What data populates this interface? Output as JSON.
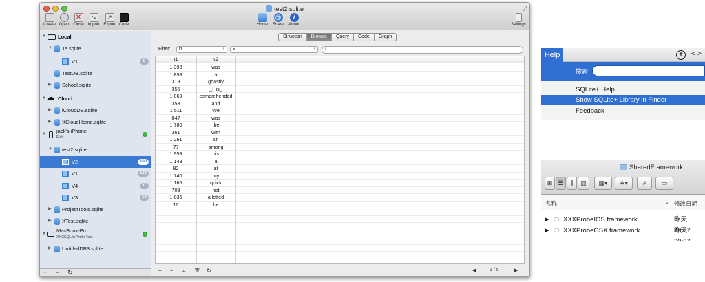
{
  "window": {
    "title": "test2.sqlite",
    "toolbar": {
      "left": [
        {
          "label": "Create",
          "icon": "create-icon"
        },
        {
          "label": "Open",
          "icon": "open-icon"
        },
        {
          "label": "Close",
          "icon": "close-icon"
        },
        {
          "label": "Import",
          "icon": "import-icon"
        },
        {
          "label": "Export",
          "icon": "export-icon"
        },
        {
          "label": "Code",
          "icon": "code-icon"
        }
      ],
      "center": [
        {
          "label": "Home",
          "icon": "home-icon"
        },
        {
          "label": "Share",
          "icon": "share-icon"
        },
        {
          "label": "About",
          "icon": "about-icon"
        }
      ],
      "right": {
        "label": "Settings",
        "icon": "settings-icon"
      }
    }
  },
  "sidebar": {
    "local": "Local",
    "cloud": "Cloud",
    "te": "Te.sqlite",
    "te_v1": "V1",
    "te_v1_badge": "0",
    "testdb": "TestDB.sqlite",
    "school": "School.sqlite",
    "icloud": "iCloudDB.sqlite",
    "xcloud": "XCloudHome.sqlite",
    "iphone": "jack's iPhone",
    "iphone_sub": "Fish",
    "test2": "test2.sqlite",
    "v2": "V2",
    "v2_badge": "100",
    "v1": "V1",
    "v1_badge": "130",
    "v4": "V4",
    "v4_badge": "0",
    "v3": "V3",
    "v3_badge": "10",
    "projecttools": "ProjectTools.sqlite",
    "xtest": "XTest.sqlite",
    "macbook": "MacBook-Pro",
    "macbook_sub": "XXXSQLiteProbeTest",
    "untitled": "UntitledDB3.sqlite",
    "footer": {
      "add": "+",
      "remove": "−",
      "refresh": "↻"
    }
  },
  "content": {
    "tabs": [
      "Struction",
      "Browse",
      "Query",
      "Code",
      "Graph"
    ],
    "active_tab": "Browse",
    "filter_label": "Filter:",
    "filter_column": "t1",
    "filter_operator": "=",
    "filter_value": "",
    "columns": [
      "t1",
      "v2"
    ],
    "rows": [
      [
        "1,398",
        "was"
      ],
      [
        "1,858",
        "a"
      ],
      [
        "313",
        "ghastly"
      ],
      [
        "355",
        "_His_"
      ],
      [
        "1,069",
        "comprehended"
      ],
      [
        "353",
        "and"
      ],
      [
        "1,511",
        "We"
      ],
      [
        "847",
        "was"
      ],
      [
        "1,780",
        "the"
      ],
      [
        "361",
        "with"
      ],
      [
        "1,261",
        "an"
      ],
      [
        "77",
        "among"
      ],
      [
        "1,959",
        "his"
      ],
      [
        "1,143",
        "a"
      ],
      [
        "82",
        "at"
      ],
      [
        "1,740",
        "my"
      ],
      [
        "1,165",
        "quick"
      ],
      [
        "708",
        "not"
      ],
      [
        "1,835",
        "allotted"
      ],
      [
        "10",
        "he"
      ]
    ],
    "bottom": {
      "add": "+",
      "remove": "−",
      "insert": "⌗",
      "delete": "🗑",
      "refresh": "↻",
      "prev": "◀",
      "next": "▶",
      "page": "1 / 5"
    }
  },
  "help_menu": {
    "title": "Help",
    "search_label": "搜索",
    "items": [
      "SQLite+ Help",
      "Show SQLite+ Library in Finder",
      "Feedback"
    ]
  },
  "finder": {
    "title": "SharedFramework",
    "col_name": "名称",
    "col_date": "修改日期",
    "rows": [
      {
        "name": "XXXProbeIOS.framework",
        "date": "昨天 20:37"
      },
      {
        "name": "XXXProbeOSX.framework",
        "date": "昨天 20:37"
      }
    ]
  },
  "colors": {
    "accent": "#3a7ad2",
    "menu_highlight": "#2f6fd1",
    "sidebar_bg": "#dfe5ee"
  }
}
